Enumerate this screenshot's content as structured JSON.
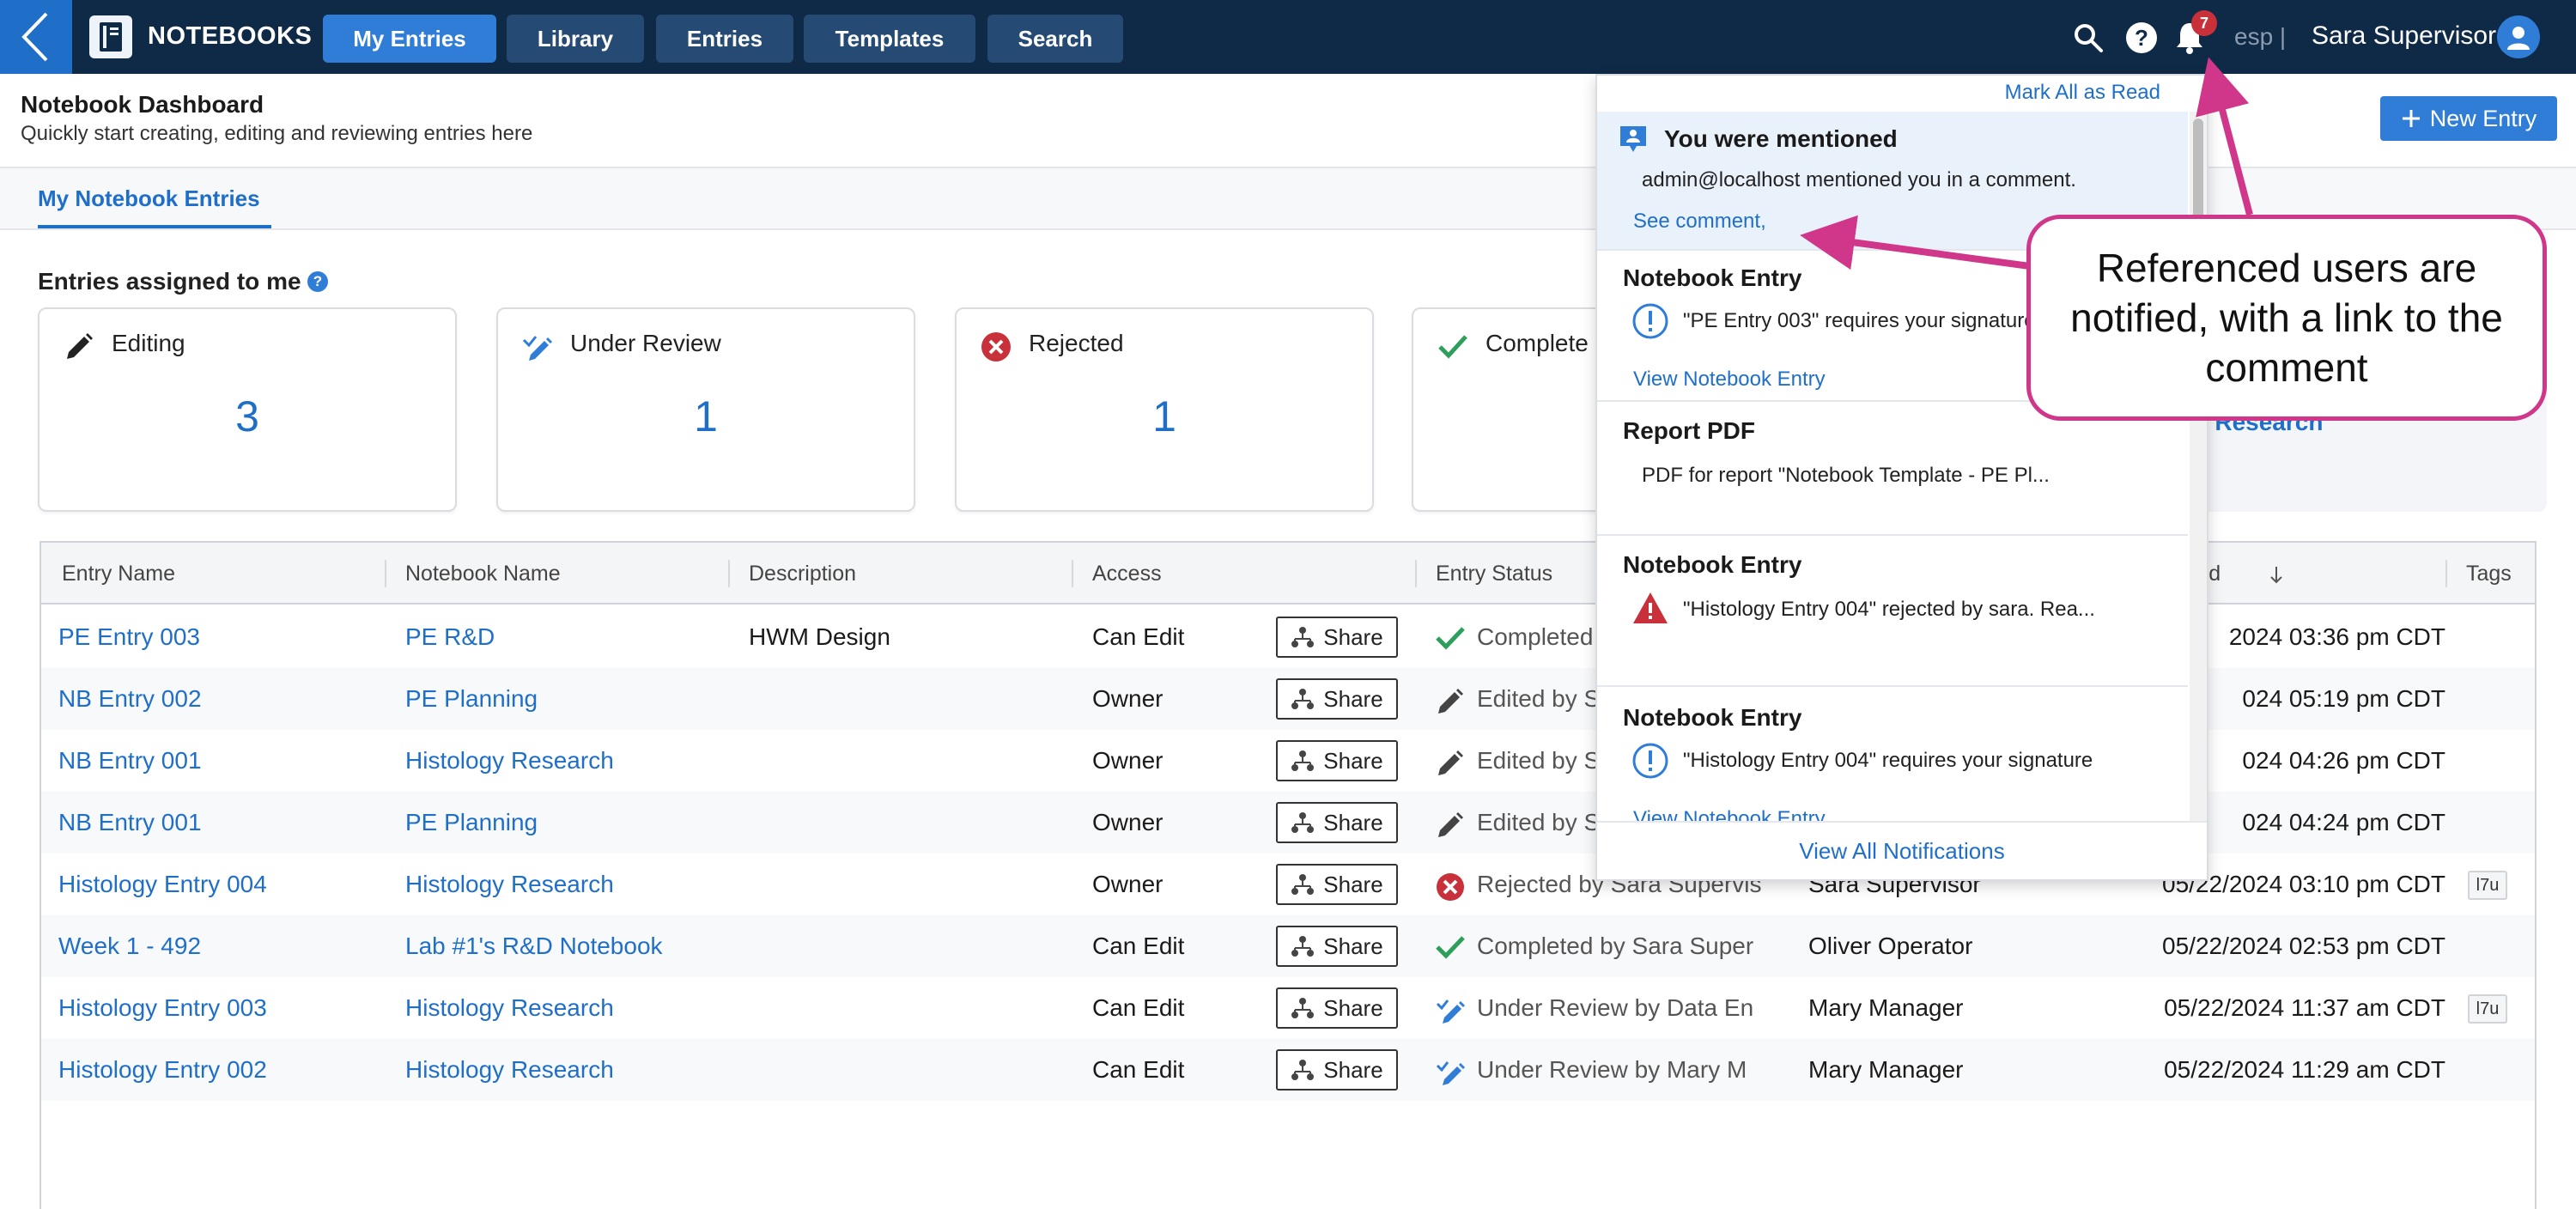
{
  "topbar": {
    "brand": "NOTEBOOKS",
    "tabs": [
      "My Entries",
      "Library",
      "Entries",
      "Templates",
      "Search"
    ],
    "notification_count": "7",
    "language": "esp |",
    "user_name": "Sara Supervisor"
  },
  "header": {
    "title": "Notebook Dashboard",
    "subtitle": "Quickly start creating, editing and reviewing entries here",
    "new_entry": "New Entry"
  },
  "subnav": {
    "tab": "My Notebook Entries"
  },
  "assigned": {
    "title": "Entries assigned to me",
    "help": "?",
    "cards": [
      {
        "label": "Editing",
        "count": "3"
      },
      {
        "label": "Under Review",
        "count": "1"
      },
      {
        "label": "Rejected",
        "count": "1"
      },
      {
        "label": "Complete",
        "count": ""
      }
    ],
    "partial_link": "y Research"
  },
  "table": {
    "headers": [
      "Entry Name",
      "Notebook Name",
      "Description",
      "Access",
      "Entry Status",
      "lated",
      "Tags"
    ],
    "share_label": "Share",
    "rows": [
      {
        "entry": "PE Entry 003",
        "notebook": "PE R&D",
        "description": "HWM Design",
        "access": "Can Edit",
        "status": "Completed",
        "status_type": "completed",
        "user": "",
        "updated": "2024 03:36 pm CDT",
        "tag": ""
      },
      {
        "entry": "NB Entry 002",
        "notebook": "PE Planning",
        "description": "",
        "access": "Owner",
        "status": "Edited by S",
        "status_type": "edited",
        "user": "",
        "updated": "024 05:19 pm CDT",
        "tag": ""
      },
      {
        "entry": "NB Entry 001",
        "notebook": "Histology Research",
        "description": "",
        "access": "Owner",
        "status": "Edited by S",
        "status_type": "edited",
        "user": "",
        "updated": "024 04:26 pm CDT",
        "tag": ""
      },
      {
        "entry": "NB Entry 001",
        "notebook": "PE Planning",
        "description": "",
        "access": "Owner",
        "status": "Edited by S",
        "status_type": "edited",
        "user": "",
        "updated": "024 04:24 pm CDT",
        "tag": ""
      },
      {
        "entry": "Histology Entry 004",
        "notebook": "Histology Research",
        "description": "",
        "access": "Owner",
        "status": "Rejected by Sara Supervis",
        "status_type": "rejected",
        "user": "Sara Supervisor",
        "updated": "05/22/2024 03:10 pm CDT",
        "tag": "l7u"
      },
      {
        "entry": "Week 1 - 492",
        "notebook": "Lab #1's R&D Notebook",
        "description": "",
        "access": "Can Edit",
        "status": "Completed by Sara Super",
        "status_type": "completed",
        "user": "Oliver Operator",
        "updated": "05/22/2024 02:53 pm CDT",
        "tag": ""
      },
      {
        "entry": "Histology Entry 003",
        "notebook": "Histology Research",
        "description": "",
        "access": "Can Edit",
        "status": "Under Review by Data En",
        "status_type": "review",
        "user": "Mary Manager",
        "updated": "05/22/2024 11:37 am CDT",
        "tag": "l7u"
      },
      {
        "entry": "Histology Entry 002",
        "notebook": "Histology Research",
        "description": "",
        "access": "Can Edit",
        "status": "Under Review by Mary M",
        "status_type": "review",
        "user": "Mary Manager",
        "updated": "05/22/2024 11:29 am CDT",
        "tag": ""
      }
    ]
  },
  "notifications": {
    "mark_all": "Mark All as Read",
    "items": [
      {
        "title": "You were mentioned",
        "text": "admin@localhost mentioned you in a comment.",
        "link": "See comment,",
        "kind": "mention"
      },
      {
        "title": "Notebook Entry",
        "text": "\"PE Entry 003\" requires your signature",
        "link": "View Notebook Entry",
        "kind": "info"
      },
      {
        "title": "Report PDF",
        "text": "PDF for report \"Notebook Template - PE Pl...",
        "link": "",
        "kind": "plain"
      },
      {
        "title": "Notebook Entry",
        "text": "\"Histology Entry 004\" rejected by sara. Rea...",
        "link": "",
        "kind": "warning"
      },
      {
        "title": "Notebook Entry",
        "text": "\"Histology Entry 004\" requires your signature",
        "link": "View Notebook Entry",
        "kind": "info"
      }
    ],
    "view_all": "View All Notifications"
  },
  "callout": {
    "text": "Referenced users are notified, with a link to the comment"
  },
  "colors": {
    "navy": "#0f2a47",
    "blue": "#2f7dd6",
    "link": "#1f6fc9",
    "callout": "#d0368a",
    "green": "#2e9e5b",
    "red": "#c8303a"
  }
}
